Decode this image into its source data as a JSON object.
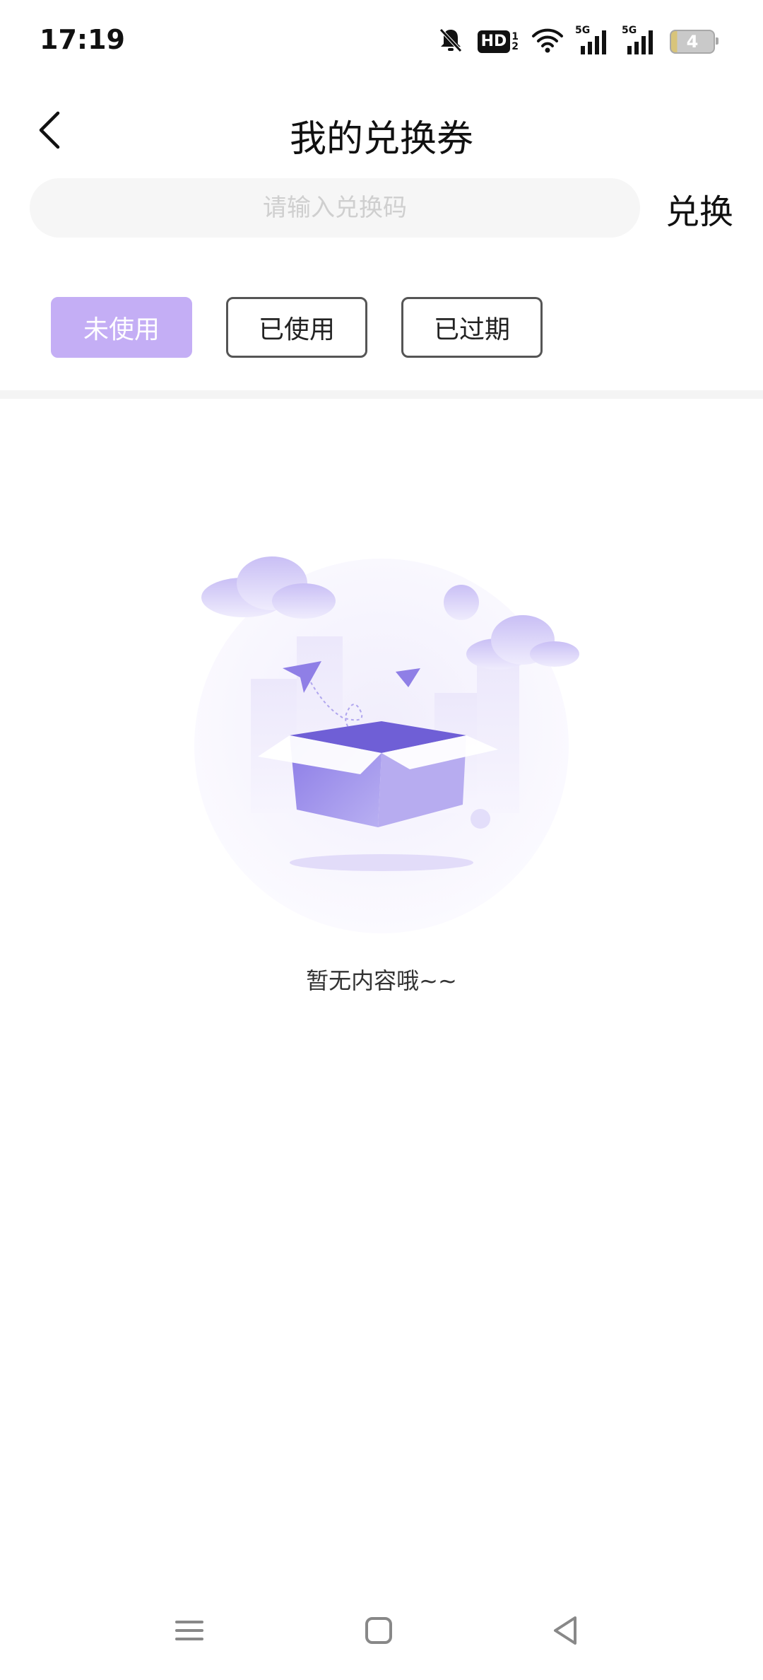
{
  "status_bar": {
    "time": "17:19",
    "hd_label": "HD",
    "hd_sub_top": "1",
    "hd_sub_bottom": "2",
    "signal1_label": "5G",
    "signal2_label": "5G",
    "battery_level": "4",
    "icons": [
      "bell-off-icon",
      "hd-icon",
      "wifi-icon",
      "signal-5g-icon",
      "signal-5g-icon",
      "battery-icon"
    ]
  },
  "header": {
    "title": "我的兑换券",
    "back_icon": "chevron-left-icon"
  },
  "redeem": {
    "placeholder": "请输入兑换码",
    "value": "",
    "button_label": "兑换"
  },
  "tabs": [
    {
      "label": "未使用",
      "active": true
    },
    {
      "label": "已使用",
      "active": false
    },
    {
      "label": "已过期",
      "active": false
    }
  ],
  "empty_state": {
    "message": "暂无内容哦~~",
    "illustration": "empty-box-illustration"
  },
  "nav_bar": {
    "icons": [
      "menu-icon",
      "home-icon",
      "back-icon"
    ]
  },
  "colors": {
    "accent": "#c4aef5",
    "illustration_primary": "#8f7fe6",
    "input_bg": "#f6f6f6"
  }
}
